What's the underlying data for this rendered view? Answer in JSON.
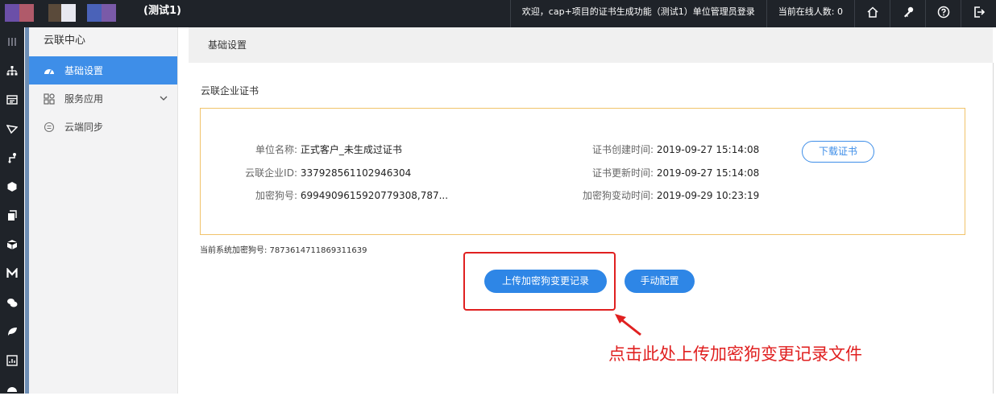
{
  "header": {
    "app_title": "(测试1)",
    "welcome_text": "欢迎，cap+项目的证书生成功能（测试1）单位管理员登录",
    "online_count_text": "当前在线人数: 0",
    "icons": [
      "home-icon",
      "key-icon",
      "help-icon",
      "logout-icon"
    ]
  },
  "rail": {
    "icons": [
      "menu-icon",
      "org-tree-icon",
      "table-icon",
      "filter-icon",
      "route-icon",
      "hexagon-icon",
      "copy-icon",
      "cube-icon",
      "m-letter-icon",
      "chat-icon",
      "leaf-icon",
      "chart-icon",
      "dashboard-icon"
    ]
  },
  "sidebar": {
    "title": "云联中心",
    "items": [
      {
        "label": "基础设置",
        "icon": "dashboard-icon",
        "active": true
      },
      {
        "label": "服务应用",
        "icon": "apps-icon",
        "active": false
      },
      {
        "label": "云端同步",
        "icon": "sync-icon",
        "active": false
      }
    ]
  },
  "main": {
    "header_title": "基础设置",
    "section_label": "云联企业证书",
    "cert": {
      "unit_name_label": "单位名称:",
      "unit_name": "正式客户_未生成过证书",
      "enterprise_id_label": "云联企业ID:",
      "enterprise_id": "337928561102946304",
      "dog_no_label": "加密狗号:",
      "dog_no": "6994909615920779308,787...",
      "created_label": "证书创建时间:",
      "created": "2019-09-27 15:14:08",
      "updated_label": "证书更新时间:",
      "updated": "2019-09-27 15:14:08",
      "dog_changed_label": "加密狗变动时间:",
      "dog_changed": "2019-09-29 10:23:19",
      "download_label": "下载证书"
    },
    "system_dog_text": "当前系统加密狗号: 7873614711869311639",
    "upload_button": "上传加密狗变更记录",
    "manual_button": "手动配置",
    "annotation": "点击此处上传加密狗变更记录文件"
  },
  "colors": {
    "topbar": "#1f2329",
    "accent": "#3e8ee8",
    "button": "#2e86e6",
    "cert_border": "#f1c36a",
    "annotation": "#e02020"
  }
}
